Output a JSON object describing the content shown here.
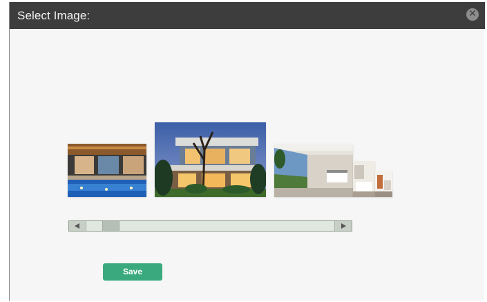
{
  "dialog": {
    "title": "Select Image:",
    "close_icon": "close-icon"
  },
  "carousel": {
    "images": [
      {
        "name": "pool-house-image",
        "description_icon": "image"
      },
      {
        "name": "modern-house-exterior-image",
        "description_icon": "image"
      },
      {
        "name": "bedroom-interior-image",
        "description_icon": "image"
      },
      {
        "name": "room-small-image",
        "description_icon": "image"
      },
      {
        "name": "room-smaller-image",
        "description_icon": "image"
      }
    ],
    "scroll_position": 0.11
  },
  "actions": {
    "save_label": "Save"
  },
  "colors": {
    "titlebar": "#3d3d3d",
    "save_button": "#3aaa7e",
    "background": "#f6f6f6"
  }
}
